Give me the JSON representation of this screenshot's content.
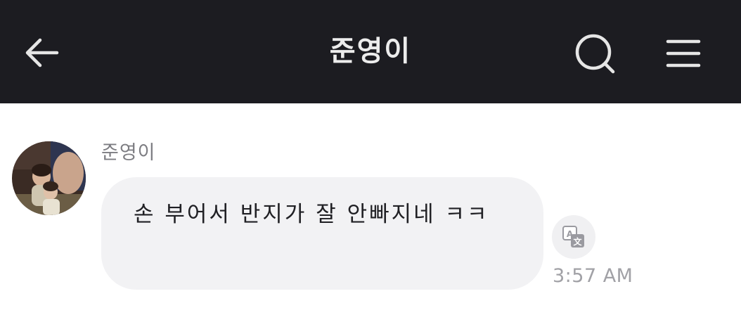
{
  "header": {
    "title": "준영이",
    "icons": {
      "back": "arrow-left-icon",
      "search": "search-icon",
      "menu": "hamburger-menu-icon"
    }
  },
  "message": {
    "sender_name": "준영이",
    "text": "손 부어서 반지가 잘 안빠지네 ㅋㅋ",
    "timestamp": "3:57 AM",
    "translate_icon": "translate-icon",
    "avatar": "profile-photo"
  },
  "colors": {
    "header_bg": "#1c1c21",
    "header_fg": "#ececec",
    "bubble_bg": "#f2f2f4",
    "meta_text": "#a1a1a6"
  }
}
